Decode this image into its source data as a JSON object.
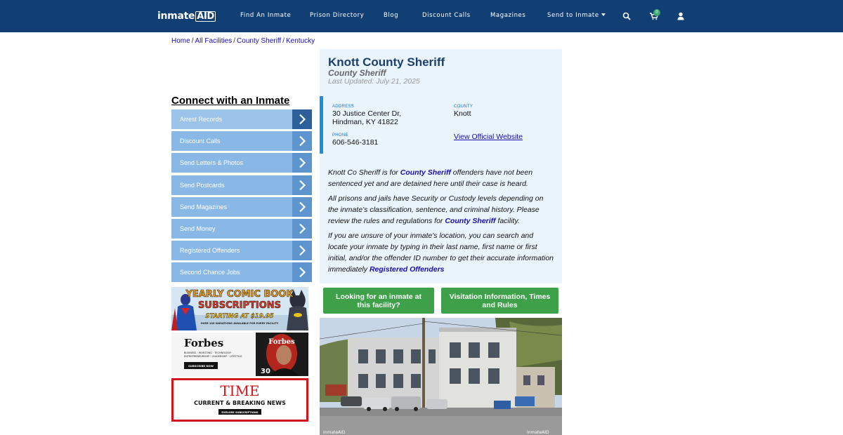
{
  "brand": {
    "name_prefix": "inmate",
    "name_suffix": "AID"
  },
  "nav": {
    "items": [
      "Find An Inmate",
      "Prison Directory",
      "Blog",
      "Discount Calls",
      "Magazines",
      "Send to Inmate"
    ],
    "cart_count": "0"
  },
  "breadcrumb": [
    "Home",
    "All Facilities",
    "County Sheriff",
    "Kentucky"
  ],
  "sidebar": {
    "title": "Connect with an Inmate",
    "items": [
      "Arrest Records",
      "Discount Calls",
      "Send Letters & Photos",
      "Send Postcards",
      "Send Magazines",
      "Send Money",
      "Registered Offenders",
      "Second Chance Jobs"
    ]
  },
  "ads": {
    "comic": {
      "line1": "YEARLY COMIC BOOK",
      "line2": "SUBSCRIPTIONS",
      "line3": "STARTING AT $19.95",
      "line4": "OVER 100 VARIATIONS AVAILABLE FOR EVERY FACILITY"
    },
    "forbes": {
      "brand": "Forbes",
      "tag1": "BUSINESS · INVESTING · TECHNOLOGY",
      "tag2": "ENTREPRENEURSHIP · LEADERSHIP · LIFESTYLE",
      "button": "SUBSCRIBE NOW",
      "cover_brand": "Forbes",
      "cover_number": "30"
    },
    "time": {
      "brand": "TIME",
      "headline": "CURRENT & BREAKING NEWS",
      "button": "EXPLORE SUBSCRIPTIONS"
    }
  },
  "facility": {
    "name": "Knott County Sheriff",
    "type": "County Sheriff",
    "last_updated": "Last Updated: July 21, 2025",
    "address_label": "ADDRESS",
    "address_line1": "30 Justice Center Dr,",
    "address_line2": "Hindman, KY 41822",
    "phone_label": "PHONE",
    "phone": "606-546-3181",
    "county_label": "COUNTY",
    "county": "Knott",
    "website_link": "View Official Website"
  },
  "description": {
    "p1_before": "Knott Co Sheriff is for ",
    "p1_link": "County Sheriff",
    "p1_after": " offenders have not been sentenced yet and are detained here until their case is heard.",
    "p2_before": "All prisons and jails have Security or Custody levels depending on the inmate’s classification, sentence, and criminal history. Please review the rules and regulations for ",
    "p2_link": "County Sheriff",
    "p2_after": " facility.",
    "p3_before": "If you are unsure of your inmate's location, you can search and locate your inmate by typing in their last name, first name or first initial, and/or the offender ID number to get their accurate information immediately ",
    "p3_link": "Registered Offenders"
  },
  "buttons": {
    "find_inmate": "Looking for an inmate at this facility?",
    "visitation": "Visitation Information, Times and Rules"
  },
  "photo": {
    "watermark_left": "inmateAID",
    "watermark_right": "inmateAID"
  },
  "colors": {
    "nav_bg": "#123f73",
    "sidebar_item": "#8ab8e6",
    "accent_green": "#3ea14a",
    "link": "#1a0dab",
    "panel_bg": "#eaf4fc"
  }
}
